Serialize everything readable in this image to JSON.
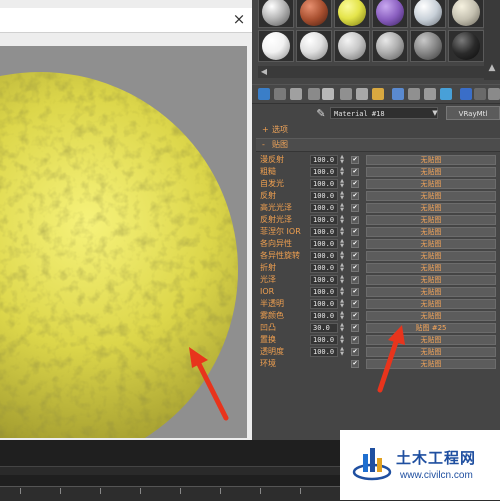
{
  "render_window": {
    "close_label": "×"
  },
  "swatches": [
    {
      "color": "#b8b8b8"
    },
    {
      "color": "#a85030"
    },
    {
      "color": "#e4e44a"
    },
    {
      "color": "#8a5fc0"
    },
    {
      "color": "#c8d0d8"
    },
    {
      "color": "#c4c0b0"
    },
    {
      "color": "#f2f2f2"
    },
    {
      "color": "#e0e0e0"
    },
    {
      "color": "#c8c8c8"
    },
    {
      "color": "#b0b0b0"
    },
    {
      "color": "#8a8a8a"
    },
    {
      "color": "#2a2a2a"
    }
  ],
  "material": {
    "name": "Material #18",
    "type_button": "VRayMtl"
  },
  "rollouts": {
    "basic_label": "选项",
    "maps_label": "贴图"
  },
  "maps": [
    {
      "label": "漫反射",
      "amount": "100.0",
      "checked": true,
      "button": "无贴图"
    },
    {
      "label": "粗糙",
      "amount": "100.0",
      "checked": true,
      "button": "无贴图"
    },
    {
      "label": "自发光",
      "amount": "100.0",
      "checked": true,
      "button": "无贴图"
    },
    {
      "label": "反射",
      "amount": "100.0",
      "checked": true,
      "button": "无贴图"
    },
    {
      "label": "高光光泽",
      "amount": "100.0",
      "checked": true,
      "button": "无贴图"
    },
    {
      "label": "反射光泽",
      "amount": "100.0",
      "checked": true,
      "button": "无贴图"
    },
    {
      "label": "菲涅尔 IOR",
      "amount": "100.0",
      "checked": true,
      "button": "无贴图"
    },
    {
      "label": "各向异性",
      "amount": "100.0",
      "checked": true,
      "button": "无贴图"
    },
    {
      "label": "各异性旋转",
      "amount": "100.0",
      "checked": true,
      "button": "无贴图"
    },
    {
      "label": "折射",
      "amount": "100.0",
      "checked": true,
      "button": "无贴图"
    },
    {
      "label": "光泽",
      "amount": "100.0",
      "checked": true,
      "button": "无贴图"
    },
    {
      "label": "IOR",
      "amount": "100.0",
      "checked": true,
      "button": "无贴图"
    },
    {
      "label": "半透明",
      "amount": "100.0",
      "checked": true,
      "button": "无贴图"
    },
    {
      "label": "雾颜色",
      "amount": "100.0",
      "checked": true,
      "button": "无贴图"
    },
    {
      "label": "凹凸",
      "amount": "30.0",
      "checked": true,
      "button": "贴图 #25"
    },
    {
      "label": "置换",
      "amount": "100.0",
      "checked": true,
      "button": "无贴图"
    },
    {
      "label": "透明度",
      "amount": "100.0",
      "checked": true,
      "button": "无贴图"
    },
    {
      "label": "环境",
      "amount": "",
      "checked": true,
      "button": "无贴图"
    }
  ],
  "watermark": {
    "title": "土木工程网",
    "url": "www.civilcn.com"
  }
}
